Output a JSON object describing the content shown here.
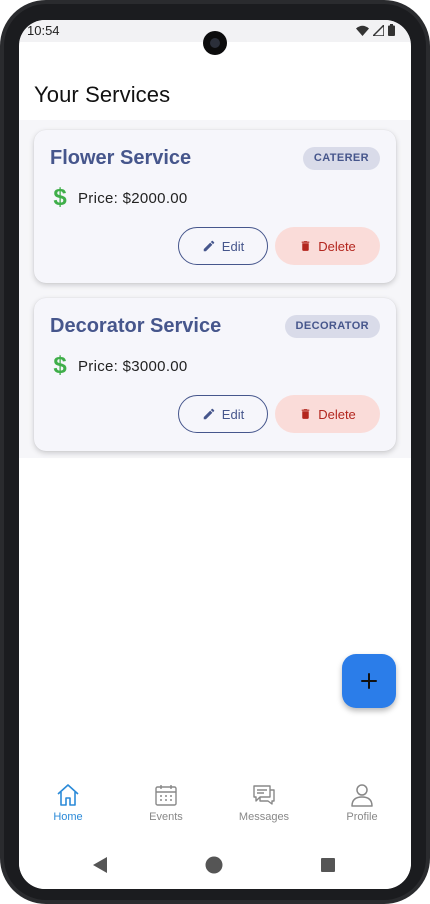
{
  "status_bar": {
    "time": "10:54"
  },
  "page": {
    "title": "Your Services"
  },
  "services": [
    {
      "name": "Flower Service",
      "category": "CATERER",
      "price_label": "Price: $2000.00",
      "edit_label": "Edit",
      "delete_label": "Delete"
    },
    {
      "name": "Decorator Service",
      "category": "DECORATOR",
      "price_label": "Price: $3000.00",
      "edit_label": "Edit",
      "delete_label": "Delete"
    }
  ],
  "icons": {
    "price": "dollar-icon",
    "edit": "pencil-icon",
    "delete": "trash-icon",
    "fab": "plus-icon"
  },
  "fab": {
    "label": "+"
  },
  "bottom_nav": [
    {
      "label": "Home",
      "icon": "home-icon",
      "active": true
    },
    {
      "label": "Events",
      "icon": "calendar-icon",
      "active": false
    },
    {
      "label": "Messages",
      "icon": "chat-icon",
      "active": false
    },
    {
      "label": "Profile",
      "icon": "person-icon",
      "active": false
    }
  ],
  "colors": {
    "accent": "#46568c",
    "price_icon": "#3fae49",
    "delete_bg": "#fadcd9",
    "delete_text": "#b3261e",
    "fab": "#2b7de9",
    "nav_active": "#2b8ad8"
  }
}
